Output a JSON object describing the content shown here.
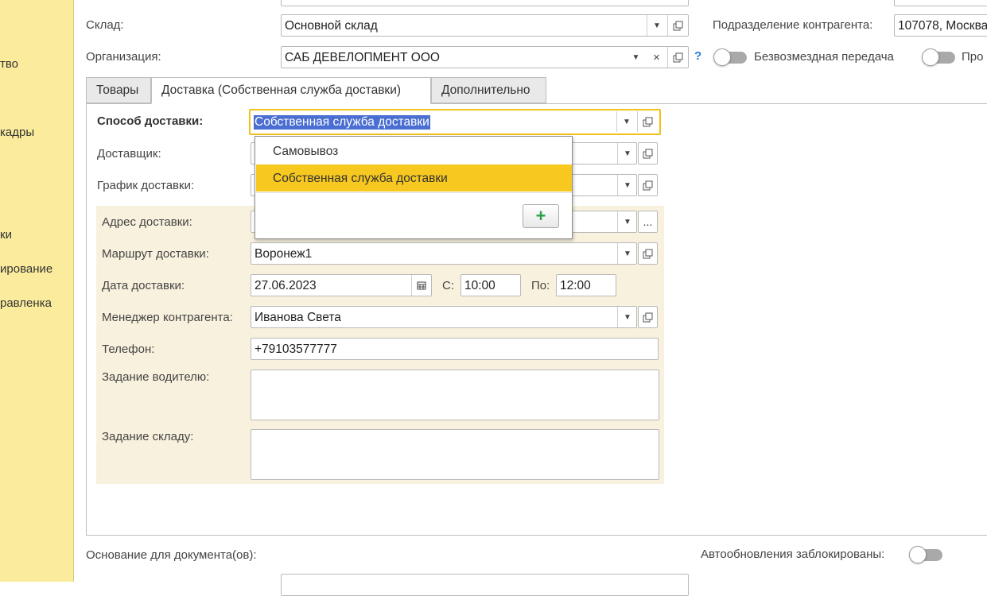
{
  "colors": {
    "sidebar_bg": "#fbec9d",
    "highlight": "#f7c820",
    "panel_bg": "#f8f1dd",
    "selection": "#4a6ed1",
    "add_green": "#26a146"
  },
  "sidebar": {
    "items": [
      "тво",
      "кадры",
      "ки",
      "ирование",
      "равленка"
    ]
  },
  "header": {
    "warehouse_label": "Склад:",
    "warehouse_value": "Основной склад",
    "org_label": "Организация:",
    "org_value": "САБ ДЕВЕЛОПМЕНТ ООО",
    "help_mark": "?",
    "subdivision_label": "Подразделение контрагента:",
    "subdivision_value": "107078, Москва",
    "free_transfer_label": "Безвозмездная передача",
    "cutoff_label": "Про"
  },
  "tabs": [
    "Товары",
    "Доставка (Собственная служба доставки)",
    "Дополнительно"
  ],
  "delivery": {
    "method_label": "Способ доставки:",
    "method_value": "Собственная служба доставки",
    "carrier_label": "Доставщик:",
    "schedule_label": "График доставки:",
    "address_label": "Адрес доставки:",
    "route_label": "Маршрут доставки:",
    "route_value": "Воронеж1",
    "date_label": "Дата доставки:",
    "date_value": "27.06.2023",
    "from_label": "С:",
    "from_value": "10:00",
    "to_label": "По:",
    "to_value": "12:00",
    "manager_label": "Менеджер контрагента:",
    "manager_value": "Иванова Света",
    "phone_label": "Телефон:",
    "phone_value": "+79103577777",
    "driver_task_label": "Задание водителю:",
    "driver_task_value": "",
    "warehouse_task_label": "Задание складу:",
    "warehouse_task_value": "",
    "more_button": "..."
  },
  "dropdown": {
    "options": [
      "Самовывоз",
      "Собственная служба доставки"
    ],
    "selected": "Собственная служба доставки",
    "add_symbol": "+"
  },
  "footer": {
    "basis_label": "Основание для документа(ов):",
    "auto_update_label": "Автообновления заблокированы:"
  }
}
